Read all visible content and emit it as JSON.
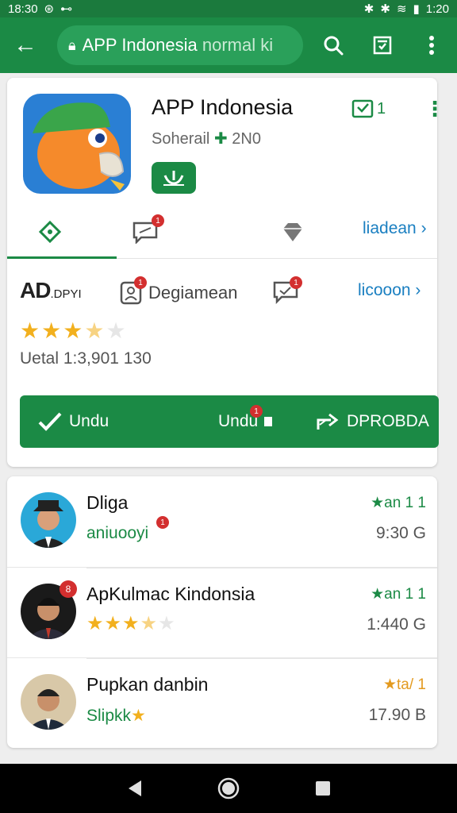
{
  "status": {
    "time": "18:30",
    "right": "1:20"
  },
  "appbar": {
    "url_main": "APP Indonesia",
    "url_dim": "normal ki"
  },
  "app": {
    "title": "APP Indonesia",
    "subtitle_a": "Soherail",
    "subtitle_b": "2N0",
    "top_count": "1"
  },
  "tabs": {
    "link": "liadean"
  },
  "row2": {
    "logo_big": "AD",
    "logo_small": ".DPYI",
    "label": "Degiamean",
    "link": "licooon"
  },
  "rating": {
    "stars": 3.5
  },
  "detail": "Uetal 1:3,901 130",
  "actions": [
    {
      "label": "Undu"
    },
    {
      "label": "Undu"
    },
    {
      "label": "DPROBDA"
    }
  ],
  "list": [
    {
      "title": "Dliga",
      "sub": "aniuooyi",
      "right_top": "★an 1 1",
      "right_bot": "9:30 G",
      "stars": null
    },
    {
      "title": "ApKulmac Kindonsia",
      "sub": null,
      "right_top": "★an 1 1",
      "right_bot": "1:440 G",
      "stars": 3.5
    },
    {
      "title": "Pupkan danbin",
      "sub": "Slipkk",
      "right_top": "★ta/ 1",
      "right_bot": "17.90 B",
      "stars": null
    }
  ],
  "colors": {
    "primary": "#1b8a45",
    "link": "#1a7fc1",
    "star": "#f2b01e",
    "badge": "#d32f2f"
  }
}
